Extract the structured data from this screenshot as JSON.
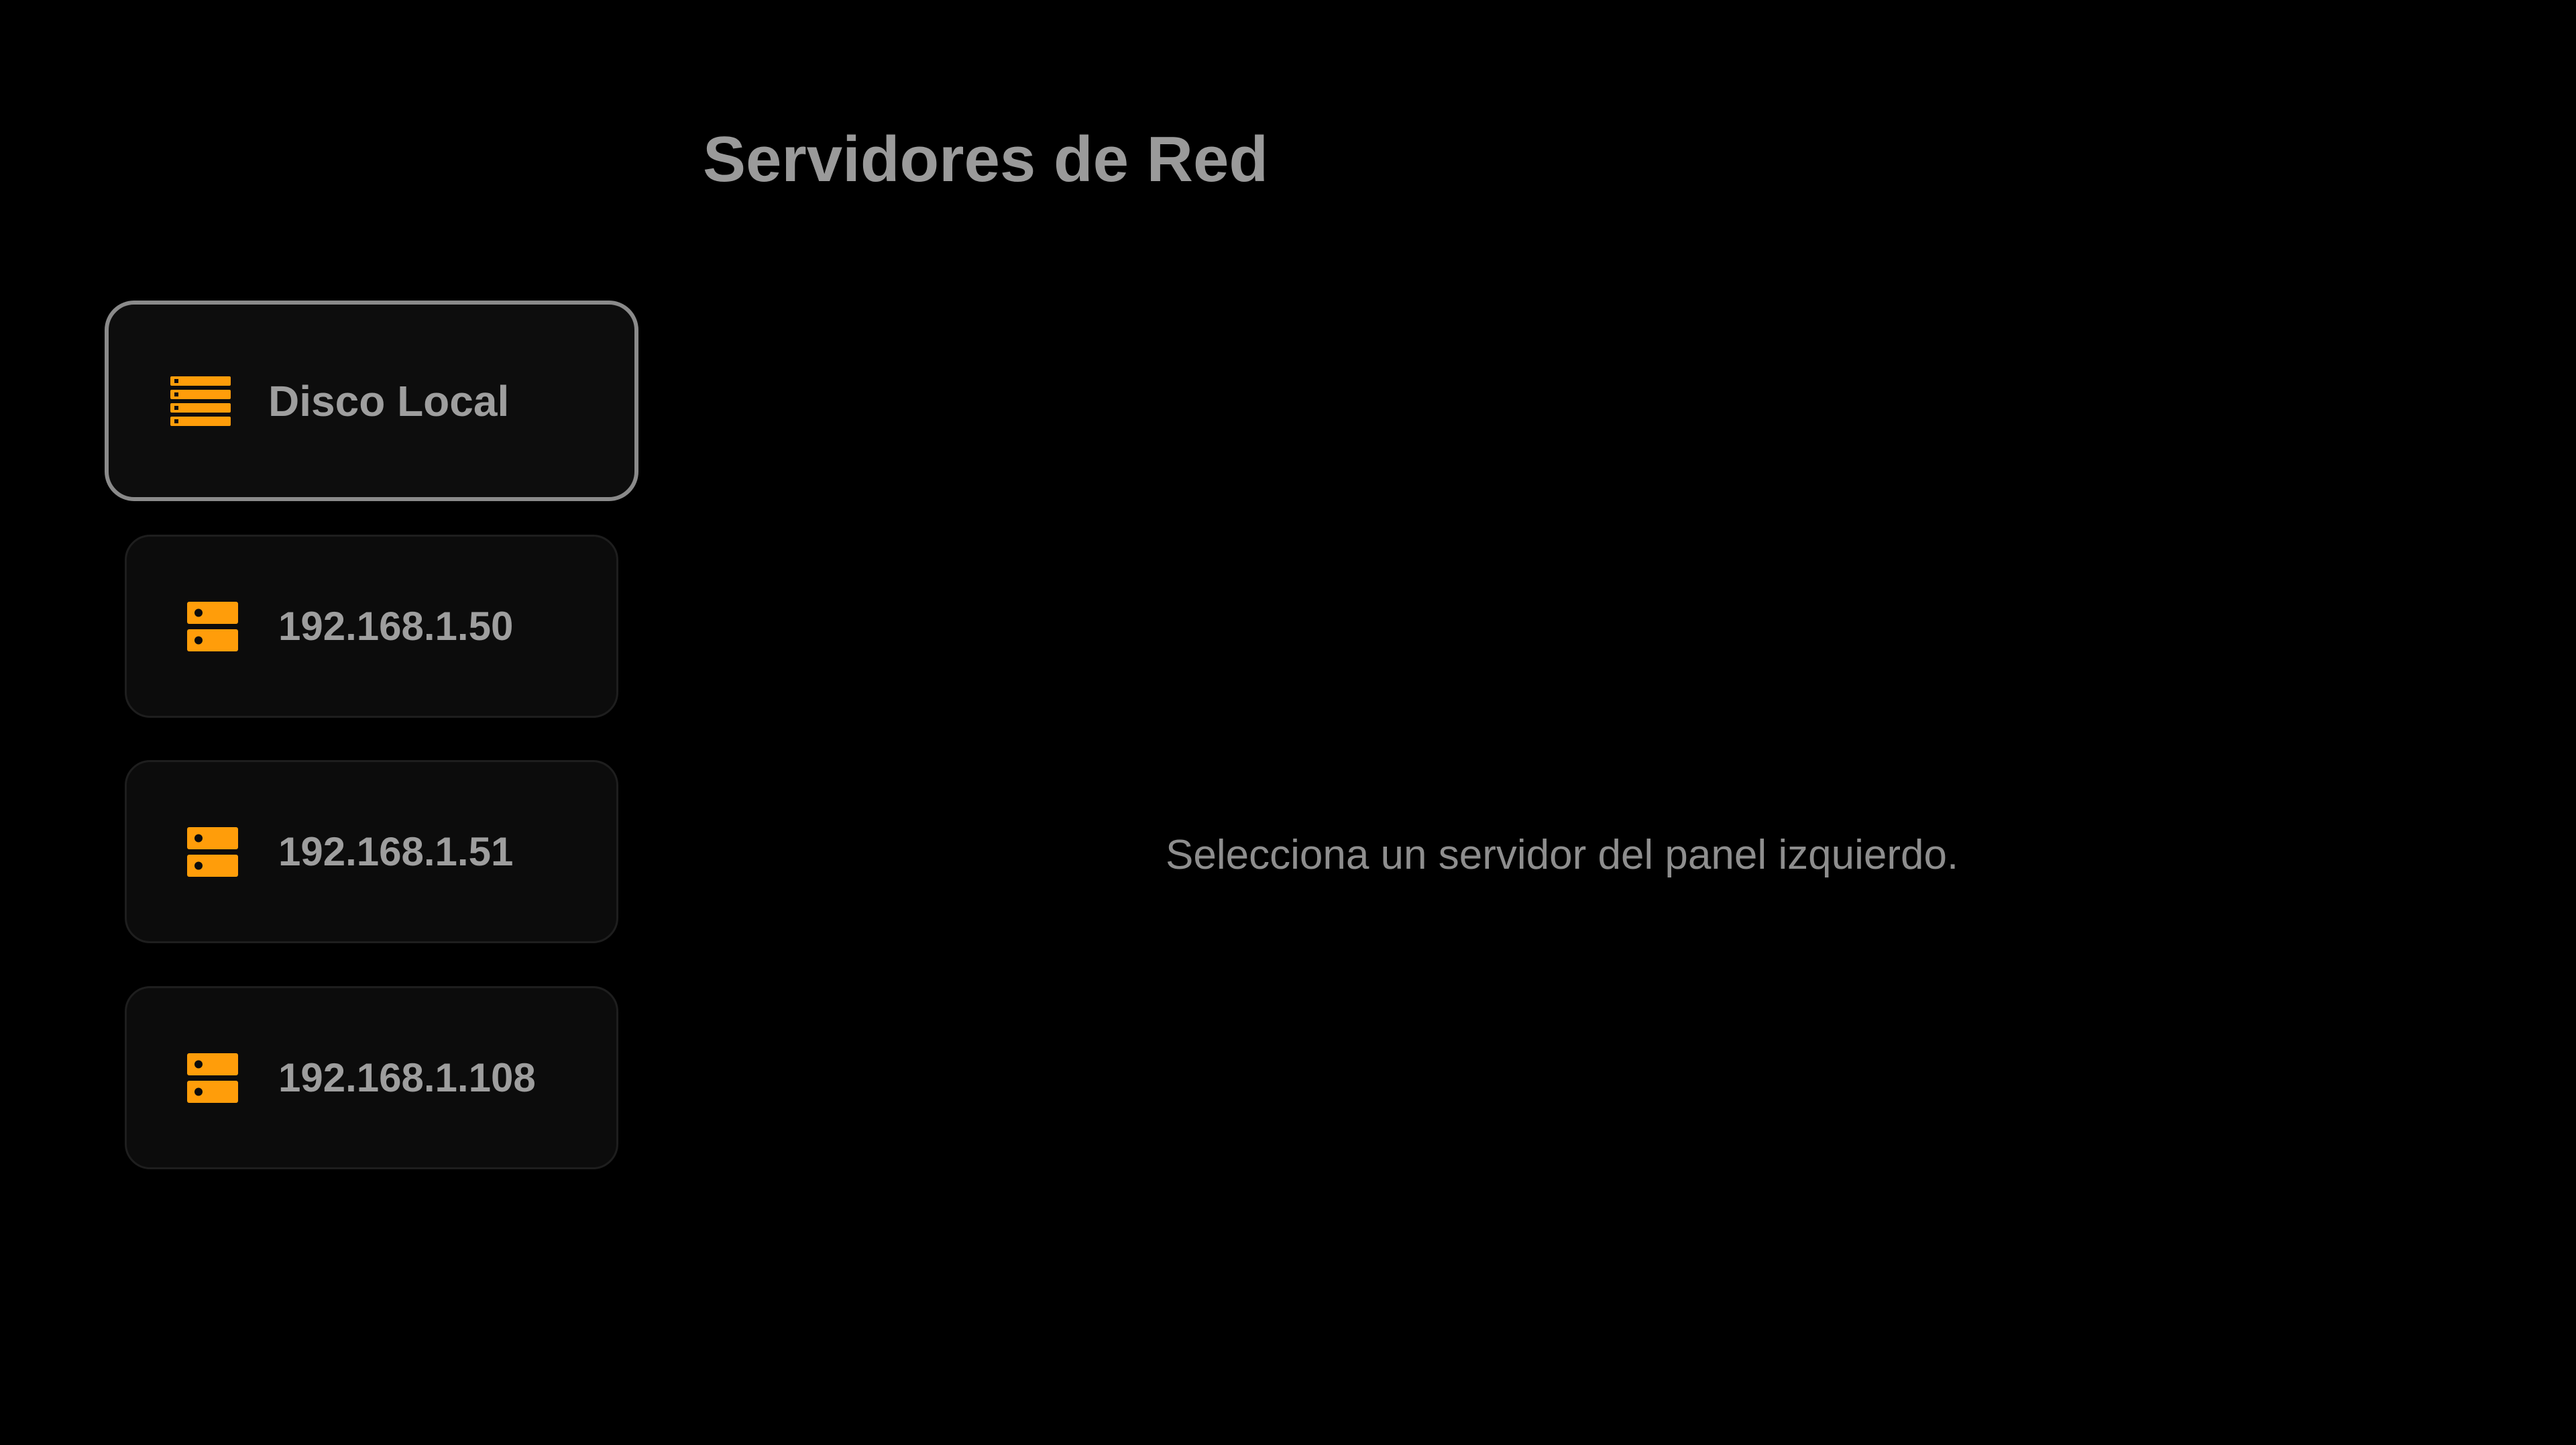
{
  "header": {
    "title": "Servidores de Red"
  },
  "sidebar": {
    "items": [
      {
        "label": "Disco Local",
        "icon": "storage-list-icon",
        "focused": true
      },
      {
        "label": "192.168.1.50",
        "icon": "server-icon",
        "focused": false
      },
      {
        "label": "192.168.1.51",
        "icon": "server-icon",
        "focused": false
      },
      {
        "label": "192.168.1.108",
        "icon": "server-icon",
        "focused": false
      }
    ]
  },
  "main": {
    "empty_message": "Selecciona un servidor del panel izquierdo."
  },
  "colors": {
    "background": "#000000",
    "accent": "#FF9D0A",
    "focus_border": "#8A8A8A",
    "text": "#9E9E9E"
  }
}
